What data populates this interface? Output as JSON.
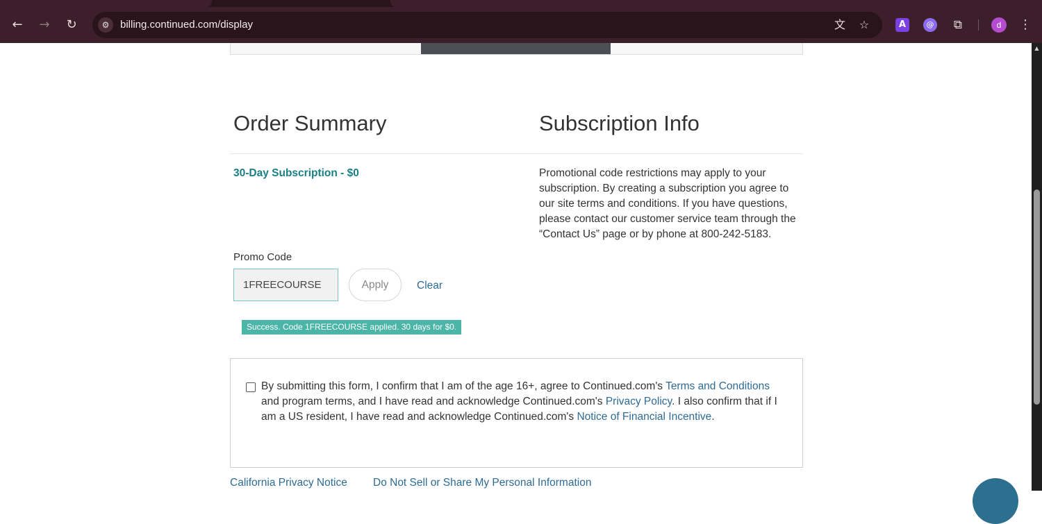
{
  "browser": {
    "url": "billing.continued.com/display",
    "back_icon": "←",
    "forward_icon": "→",
    "reload_icon": "↻",
    "site_info_icon": "⚙",
    "translate_icon": "文",
    "bookmark_icon": "☆",
    "ext_a_label": "A",
    "ext_b_label": "@",
    "extensions_icon": "⧉",
    "avatar_letter": "d",
    "menu_icon": "⋮"
  },
  "order_summary": {
    "title": "Order Summary",
    "product": "30-Day Subscription - $0",
    "promo_label": "Promo Code",
    "promo_value": "1FREECOURSE",
    "apply_label": "Apply",
    "clear_label": "Clear",
    "success_message": "Success. Code 1FREECOURSE applied. 30 days for $0."
  },
  "subscription_info": {
    "title": "Subscription Info",
    "text": "Promotional code restrictions may apply to your subscription. By creating a subscription you agree to our site terms and conditions. If you have questions, please contact our customer service team through the “Contact Us” page or by phone at 800-242-5183."
  },
  "consent": {
    "part1": "By submitting this form, I confirm that I am of the age 16+, agree to Continued.com's ",
    "terms_link": "Terms and Conditions",
    "part2": " and program terms, and I have read and acknowledge Continued.com's ",
    "privacy_link": "Privacy Policy",
    "part3": ". I also confirm that if I am a US resident, I have read and acknowledge Continued.com's ",
    "incentive_link": "Notice of Financial Incentive",
    "part4": "."
  },
  "footer": {
    "california_notice": "California Privacy Notice",
    "do_not_sell": "Do Not Sell or Share My Personal Information"
  },
  "colors": {
    "accent_teal": "#1a7f86",
    "link_blue": "#2e6b93",
    "success_bg": "#4bb5a8",
    "chrome_bg": "#3c1f2a"
  }
}
